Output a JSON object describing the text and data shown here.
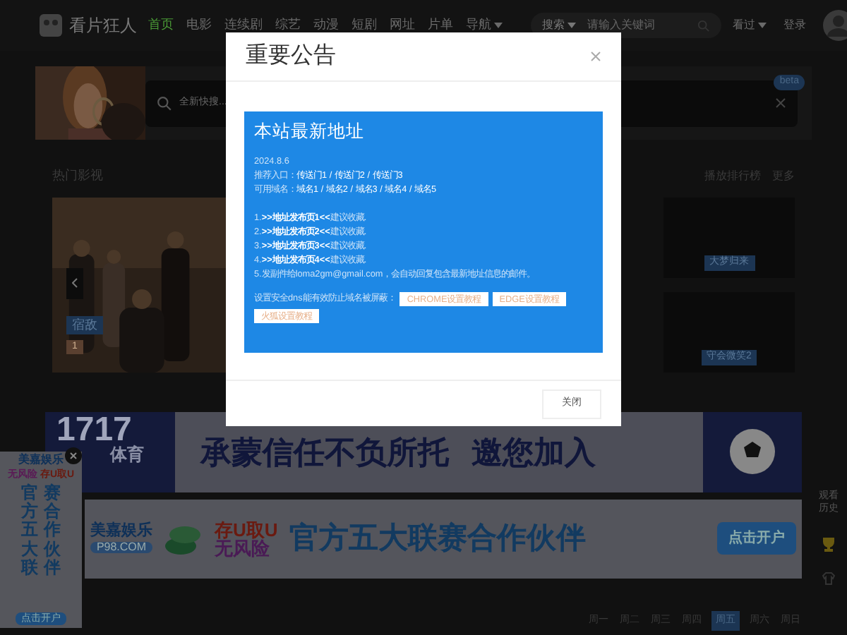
{
  "header": {
    "logo": "看片狂人",
    "nav": [
      {
        "label": "首页",
        "selected": true
      },
      {
        "label": "电影",
        "selected": false
      },
      {
        "label": "连续剧",
        "selected": false
      },
      {
        "label": "综艺",
        "selected": false
      },
      {
        "label": "动漫",
        "selected": false
      },
      {
        "label": "短剧",
        "selected": false
      },
      {
        "label": "网址",
        "selected": false
      },
      {
        "label": "片单",
        "selected": false
      },
      {
        "label": "导航",
        "selected": false
      }
    ],
    "search_scope": "搜索",
    "search": {
      "placeholder": "请输入关键词"
    },
    "history": "看过",
    "login": "登录"
  },
  "quick_search": {
    "placeholder": "全新快搜...",
    "badge": "beta"
  },
  "section": {
    "title": "热门影视",
    "links": [
      "播放排行榜",
      "更多"
    ],
    "carousel_tag": "宿敌",
    "carousel_badge": "1",
    "cards": [
      "大梦归来",
      "守会微笑2"
    ]
  },
  "modal": {
    "title": "重要公告",
    "heading": "本站最新地址",
    "date": "2024.8.6",
    "info": [
      {
        "label": "推荐入口：",
        "value": "传送门1 / 传送门2 / 传送门3"
      },
      {
        "label": "可用域名：",
        "value": "域名1 / 域名2 / 域名3 / 域名4 / 域名5"
      }
    ],
    "links": [
      {
        "num": "1.",
        "link": ">>地址发布页1<<",
        "note": "建议收藏."
      },
      {
        "num": "2.",
        "link": ">>地址发布页2<<",
        "note": "建议收藏."
      },
      {
        "num": "3.",
        "link": ">>地址发布页3<<",
        "note": "建议收藏."
      },
      {
        "num": "4.",
        "link": ">>地址发布页4<<",
        "note": "建议收藏."
      }
    ],
    "mail": "5.发副件给loma2gm@gmail.com，会自动回复包含最新地址信息的邮件。",
    "dns_text": "设置安全dns能有效防止域名被屏蔽：",
    "dns_buttons": [
      "CHROME设置教程",
      "EDGE设置教程",
      "火狐设置教程"
    ],
    "close": "关闭"
  },
  "ads": {
    "banner_1": {
      "brand": "1717",
      "brand_sub": "体育",
      "slogan": "承蒙信任不负所托",
      "slogan_2": "邀您加入"
    },
    "banner_2": {
      "brand": "美嘉娱乐",
      "domain": "P98.COM",
      "tag_1": "存U取U",
      "tag_2": "无风险",
      "slogan": "官方五大联赛合作伙伴",
      "cta": "点击开户"
    },
    "float": {
      "brand": "美嘉娱乐",
      "tag_1": "无风险",
      "tag_2": "存U取U",
      "col_1": "官方五大联",
      "col_2": "赛合作伙伴",
      "cta": "点击开户"
    }
  },
  "side": {
    "history": "观看历史"
  },
  "weekdays": [
    {
      "label": "周一",
      "selected": false
    },
    {
      "label": "周二",
      "selected": false
    },
    {
      "label": "周三",
      "selected": false
    },
    {
      "label": "周四",
      "selected": false
    },
    {
      "label": "周五",
      "selected": true
    },
    {
      "label": "周六",
      "selected": false
    },
    {
      "label": "周日",
      "selected": false
    }
  ]
}
